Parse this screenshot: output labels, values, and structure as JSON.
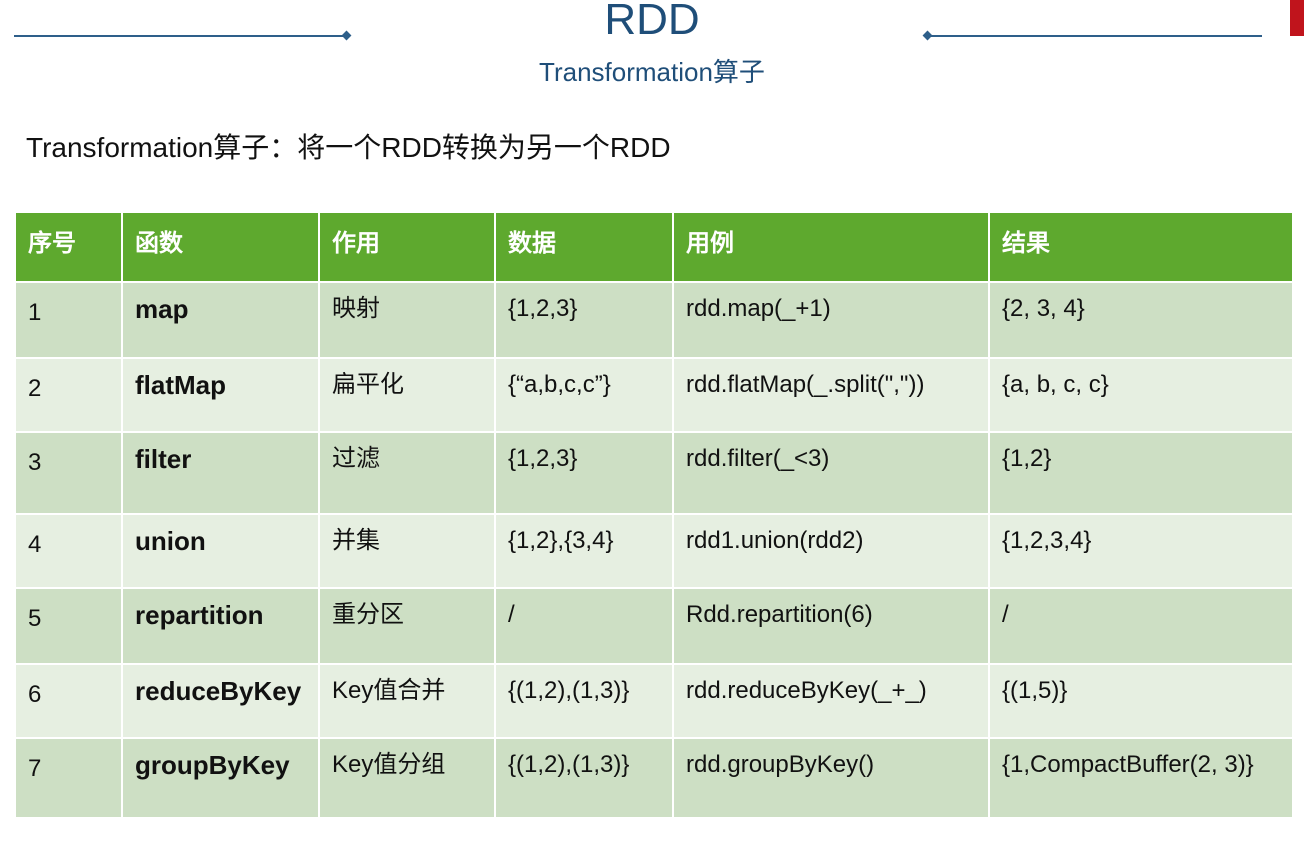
{
  "header": {
    "title": "RDD",
    "subtitle": "Transformation算子",
    "accent_color": "#1f4e79"
  },
  "intro": "Transformation算子：将一个RDD转换为另一个RDD",
  "table": {
    "header_color": "#5ea92e",
    "columns": [
      "序号",
      "函数",
      "作用",
      "数据",
      "用例",
      "结果"
    ],
    "rows": [
      {
        "index": "1",
        "function": "map",
        "purpose": "映射",
        "data": "{1,2,3}",
        "example": "rdd.map(_+1)",
        "result": "{2, 3, 4}"
      },
      {
        "index": "2",
        "function": "flatMap",
        "purpose": "扁平化",
        "data": "{“a,b,c,c”}",
        "example": "rdd.flatMap(_.split(\",\"))",
        "result": "{a, b, c, c}"
      },
      {
        "index": "3",
        "function": "filter",
        "purpose": "过滤",
        "data": "{1,2,3}",
        "example": "rdd.filter(_<3)",
        "result": "{1,2}"
      },
      {
        "index": "4",
        "function": "union",
        "purpose": "并集",
        "data": "{1,2},{3,4}",
        "example": "rdd1.union(rdd2)",
        "result": "{1,2,3,4}"
      },
      {
        "index": "5",
        "function": "repartition",
        "purpose": "重分区",
        "data": "/",
        "example": "Rdd.repartition(6)",
        "result": "/"
      },
      {
        "index": "6",
        "function": "reduceByKey",
        "purpose": "Key值合并",
        "data": "{(1,2),(1,3)}",
        "example": "rdd.reduceByKey(_+_)",
        "result": "{(1,5)}"
      },
      {
        "index": "7",
        "function": "groupByKey",
        "purpose": "Key值分组",
        "data": "{(1,2),(1,3)}",
        "example": "rdd.groupByKey()",
        "result": "{1,CompactBuffer(2, 3)}"
      }
    ]
  }
}
